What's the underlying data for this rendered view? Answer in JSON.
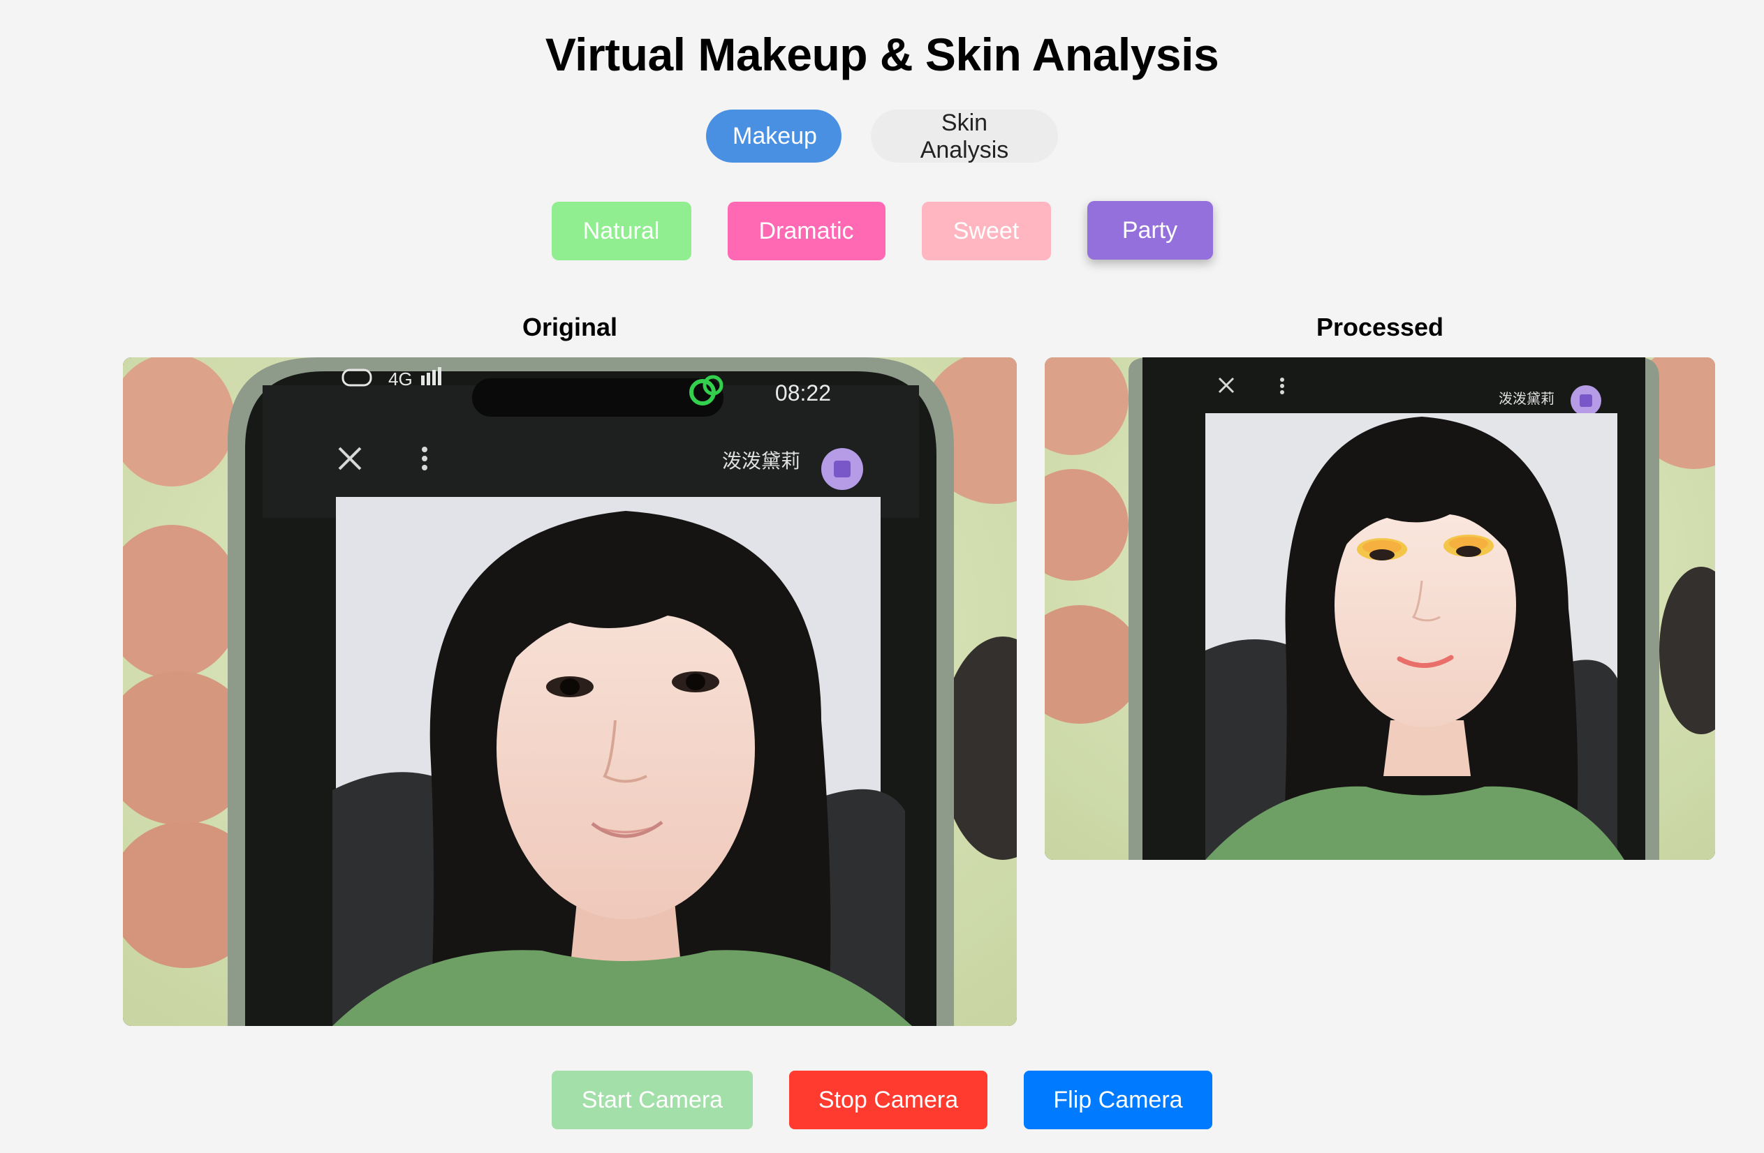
{
  "page": {
    "title": "Virtual Makeup & Skin Analysis"
  },
  "mode_tabs": [
    {
      "label": "Makeup",
      "active": true
    },
    {
      "label": "Skin Analysis",
      "active": false
    }
  ],
  "makeup_styles": [
    {
      "label": "Natural",
      "color": "#90ee90",
      "selected": false
    },
    {
      "label": "Dramatic",
      "color": "#ff69b4",
      "selected": false
    },
    {
      "label": "Sweet",
      "color": "#ffb6c1",
      "selected": false
    },
    {
      "label": "Party",
      "color": "#9370db",
      "selected": true
    }
  ],
  "panels": {
    "original_label": "Original",
    "processed_label": "Processed"
  },
  "phone_screen": {
    "status_time": "08:22",
    "status_network": "4G",
    "contact_name": "泼泼黛莉"
  },
  "controls": {
    "start_label": "Start Camera",
    "start_color": "#a3dfa8",
    "stop_label": "Stop Camera",
    "stop_color": "#ff3b30",
    "flip_label": "Flip Camera",
    "flip_color": "#007aff"
  },
  "icons": {
    "close": "close-icon",
    "more": "more-vert-icon",
    "avatar": "avatar-icon",
    "app": "app-swirl-icon"
  }
}
